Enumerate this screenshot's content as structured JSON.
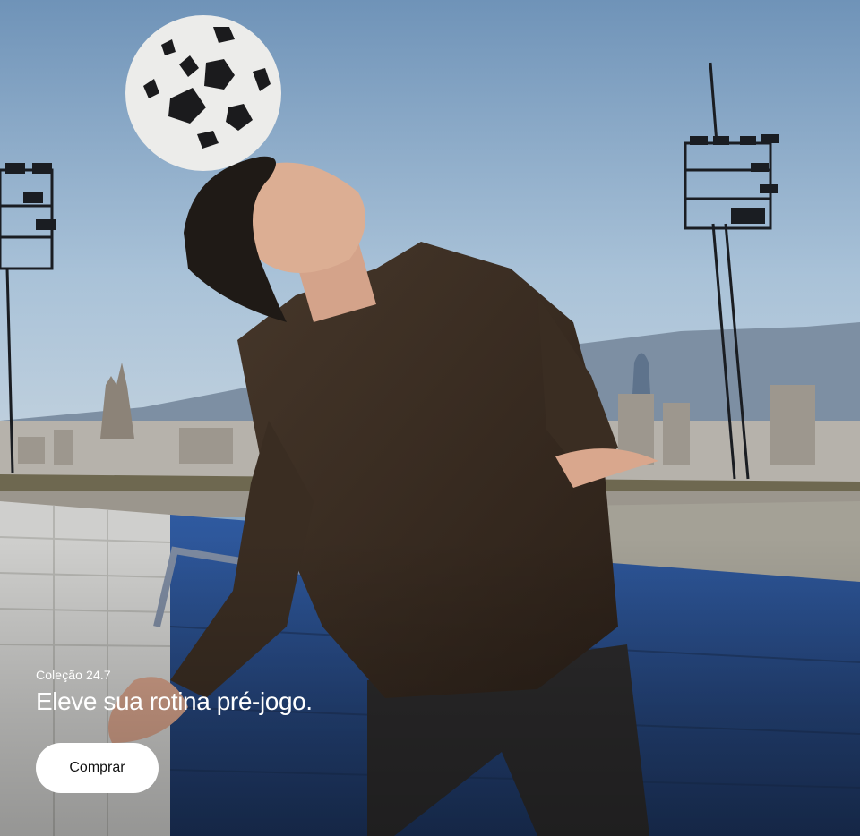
{
  "hero": {
    "eyebrow": "Coleção 24.7",
    "headline": "Eleve sua rotina pré-jogo.",
    "cta_label": "Comprar"
  },
  "colors": {
    "sky": "#8fb0cc",
    "hoodie": "#3a2c20",
    "wall_blue": "#2f5a9a",
    "cta_background": "#ffffff"
  }
}
